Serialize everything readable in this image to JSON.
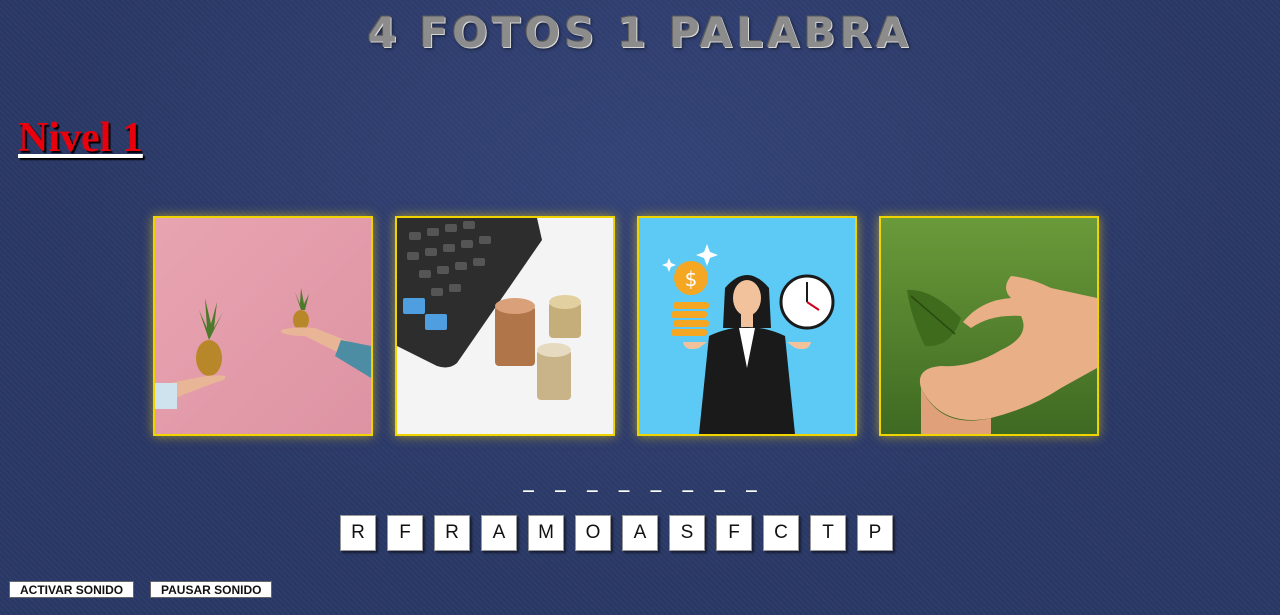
{
  "game": {
    "title": "4 FOTOS 1 PALABRA",
    "level_label": "Nivel 1"
  },
  "photos": [
    {
      "name": "pineapples-photo"
    },
    {
      "name": "calculator-coins-photo"
    },
    {
      "name": "businesswoman-money-clock-photo"
    },
    {
      "name": "hands-leaf-photo"
    }
  ],
  "answer_slots": [
    "_",
    "_",
    "_",
    "_",
    "_",
    "_",
    "_",
    "_"
  ],
  "letters": [
    "R",
    "F",
    "R",
    "A",
    "M",
    "O",
    "A",
    "S",
    "F",
    "C",
    "T",
    "P"
  ],
  "controls": {
    "activate_sound": "ACTIVAR SONIDO",
    "pause_sound": "PAUSAR SONIDO"
  },
  "colors": {
    "background": "#2a3866",
    "level_text": "#e8000d",
    "photo_border": "#f0d400"
  }
}
